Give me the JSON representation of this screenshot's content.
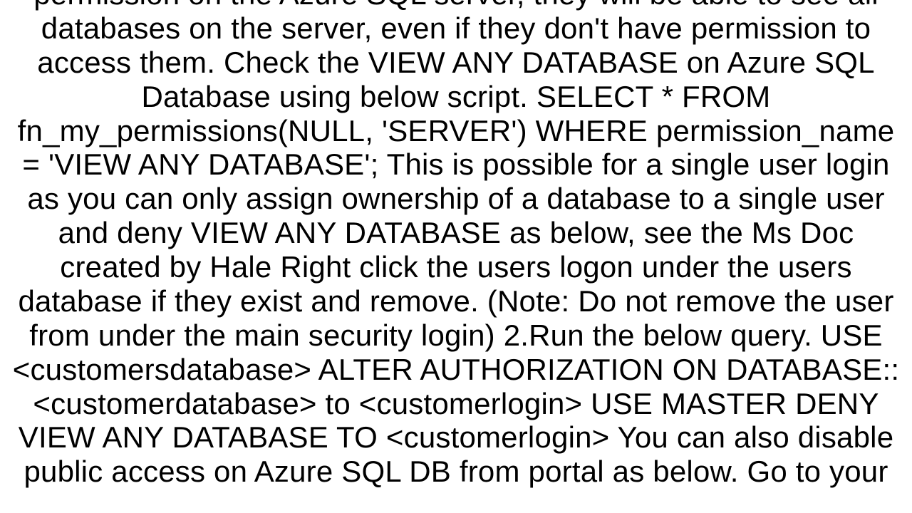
{
  "document": {
    "body_text": "permission on the Azure SQL server, they will be able to see all databases on the server, even if they don't have permission to access them. Check the VIEW ANY DATABASE on Azure SQL Database using below script. SELECT  *  FROM fn_my_permissions(NULL, 'SERVER') WHERE permission_name = 'VIEW ANY DATABASE';    This is possible for a single user login as you can only assign ownership of a database to a single user and deny VIEW ANY DATABASE as below, see the Ms Doc created by Hale  Right click the users logon under the users database if they exist and remove.   (Note: Do not remove the user from under the main security login)  2.Run the below query. USE <customersdatabase>       ALTER AUTHORIZATION ON DATABASE::<customerdatabase> to <customerlogin>           USE MASTER           DENY VIEW ANY DATABASE TO <customerlogin>   You can also disable public access on Azure SQL DB from portal as below. Go to your"
  }
}
